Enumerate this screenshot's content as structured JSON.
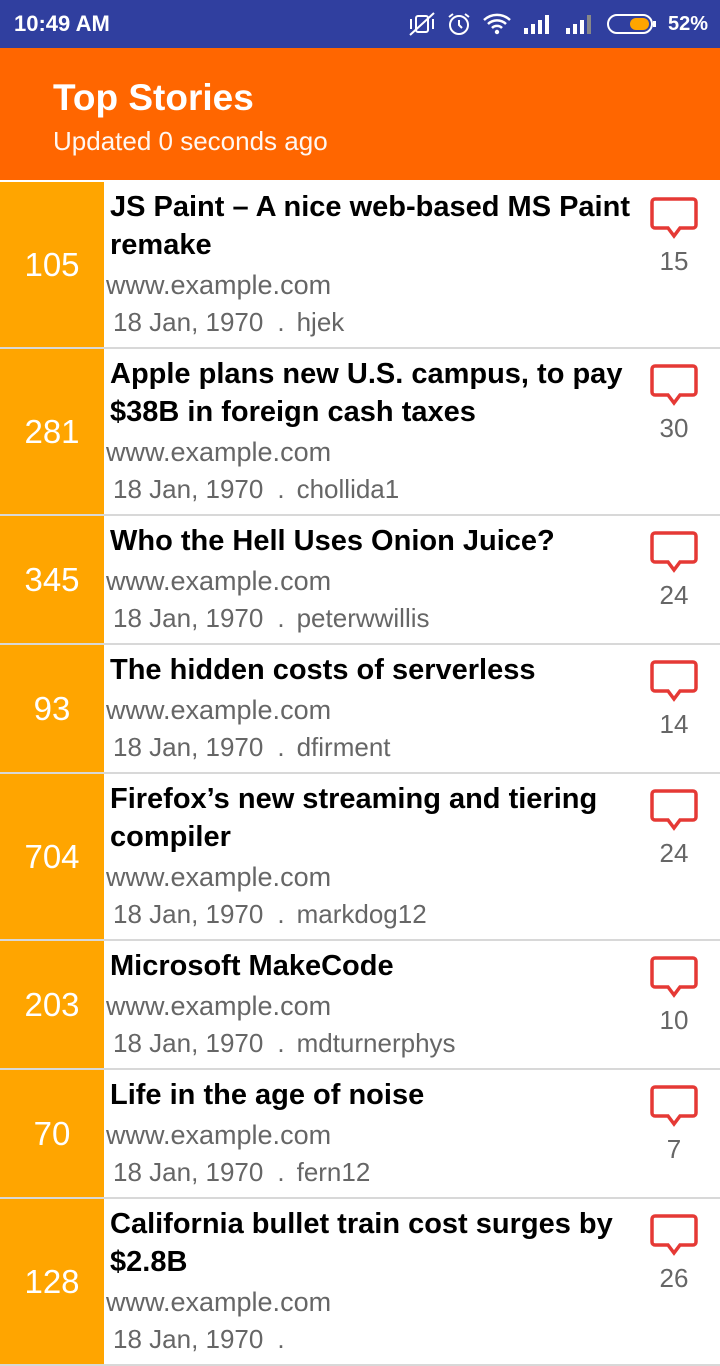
{
  "status_bar": {
    "time": "10:49 AM",
    "battery_percent": "52%",
    "icons": [
      "vibrate-off-icon",
      "alarm-icon",
      "wifi-icon",
      "signal-icon",
      "signal-icon",
      "battery-icon"
    ]
  },
  "header": {
    "title": "Top Stories",
    "subtitle": "Updated 0 seconds ago"
  },
  "colors": {
    "status_bar": "#303f9f",
    "app_bar": "#ff6600",
    "score_box": "#ffa500",
    "comment_icon": "#e53935"
  },
  "stories": [
    {
      "score": "105",
      "title": "JS Paint – A nice web-based MS Paint remake",
      "url": "www.example.com",
      "date": "18 Jan, 1970",
      "sep": ".",
      "author": "hjek",
      "comments": "15"
    },
    {
      "score": "281",
      "title": "Apple plans new U.S. campus, to pay $38B in foreign cash taxes",
      "url": "www.example.com",
      "date": "18 Jan, 1970",
      "sep": ".",
      "author": "chollida1",
      "comments": "30"
    },
    {
      "score": "345",
      "title": "Who the Hell Uses Onion Juice?",
      "url": "www.example.com",
      "date": "18 Jan, 1970",
      "sep": ".",
      "author": "peterwwillis",
      "comments": "24"
    },
    {
      "score": "93",
      "title": "The hidden costs of serverless",
      "url": "www.example.com",
      "date": "18 Jan, 1970",
      "sep": ".",
      "author": "dfirment",
      "comments": "14"
    },
    {
      "score": "704",
      "title": "Firefox’s new streaming and tiering compiler",
      "url": "www.example.com",
      "date": "18 Jan, 1970",
      "sep": ".",
      "author": "markdog12",
      "comments": "24"
    },
    {
      "score": "203",
      "title": "Microsoft MakeCode",
      "url": "www.example.com",
      "date": "18 Jan, 1970",
      "sep": ".",
      "author": "mdturnerphys",
      "comments": "10"
    },
    {
      "score": "70",
      "title": "Life in the age of noise",
      "url": "www.example.com",
      "date": "18 Jan, 1970",
      "sep": ".",
      "author": "fern12",
      "comments": "7"
    },
    {
      "score": "128",
      "title": "California bullet train cost surges by $2.8B",
      "url": "www.example.com",
      "date": "18 Jan, 1970",
      "sep": ".",
      "author": "",
      "comments": "26"
    }
  ]
}
